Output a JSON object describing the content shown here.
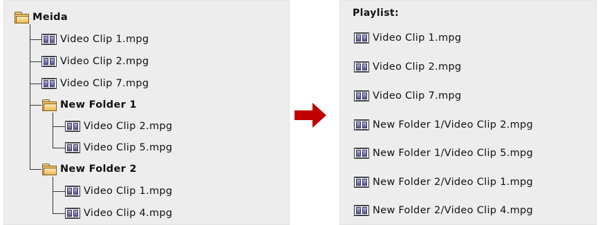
{
  "tree": {
    "root": {
      "label": "Meida",
      "icon": "folder-icon"
    },
    "items": [
      {
        "label": "Video Clip 1.mpg",
        "icon": "video-clip-icon"
      },
      {
        "label": "Video Clip 2.mpg",
        "icon": "video-clip-icon"
      },
      {
        "label": "Video Clip 7.mpg",
        "icon": "video-clip-icon"
      },
      {
        "label": "New Folder 1",
        "icon": "folder-icon"
      },
      {
        "label": "Video Clip 2.mpg",
        "icon": "video-clip-icon"
      },
      {
        "label": "Video Clip 5.mpg",
        "icon": "video-clip-icon"
      },
      {
        "label": "New Folder 2",
        "icon": "folder-icon"
      },
      {
        "label": "Video Clip 1.mpg",
        "icon": "video-clip-icon"
      },
      {
        "label": "Video Clip 4.mpg",
        "icon": "video-clip-icon"
      }
    ]
  },
  "arrow": {
    "icon": "right-arrow-icon",
    "color": "#c00000"
  },
  "playlist": {
    "title": "Playlist:",
    "items": [
      "Video Clip 1.mpg",
      "Video Clip 2.mpg",
      "Video Clip 7.mpg",
      "New Folder 1/Video Clip 2.mpg",
      "New Folder 1/Video Clip 5.mpg",
      "New Folder 2/Video Clip 1.mpg",
      "New Folder 2/Video Clip 4.mpg"
    ]
  },
  "colors": {
    "panel_bg": "#ededed",
    "arrow": "#c00000"
  }
}
